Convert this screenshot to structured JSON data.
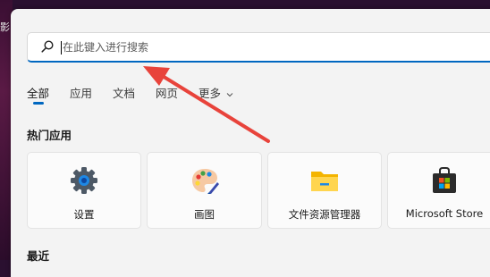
{
  "wallpaper": {
    "partial_text": "影"
  },
  "search": {
    "placeholder": "在此键入进行搜索",
    "value": ""
  },
  "tabs": [
    {
      "label": "全部",
      "active": true
    },
    {
      "label": "应用",
      "active": false
    },
    {
      "label": "文档",
      "active": false
    },
    {
      "label": "网页",
      "active": false
    },
    {
      "label": "更多",
      "active": false,
      "has_dropdown": true
    }
  ],
  "sections": {
    "top_apps_title": "热门应用",
    "recent_title": "最近"
  },
  "top_apps": [
    {
      "label": "设置",
      "icon": "settings-gear-icon"
    },
    {
      "label": "画图",
      "icon": "paint-palette-icon"
    },
    {
      "label": "文件资源管理器",
      "icon": "file-explorer-folder-icon"
    },
    {
      "label": "Microsoft Store",
      "icon": "microsoft-store-bag-icon"
    }
  ],
  "colors": {
    "accent": "#0067c0",
    "panel_bg": "#f3f3f3",
    "annotation_arrow": "#e8433b"
  }
}
